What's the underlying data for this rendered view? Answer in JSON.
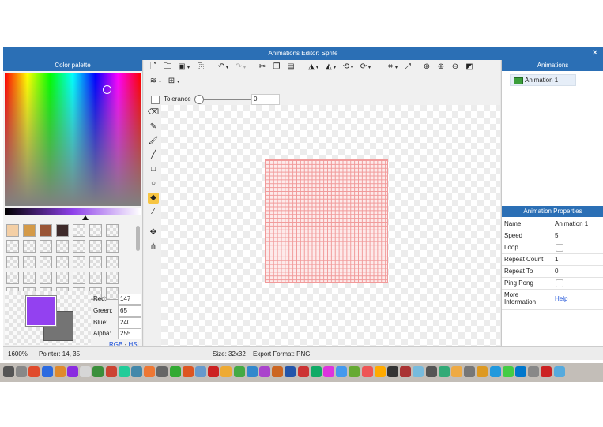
{
  "window": {
    "title": "Animations Editor: Sprite",
    "close": "✕"
  },
  "palette": {
    "title": "Color palette",
    "swatches": [
      "#f4cfa5",
      "#d49a48",
      "#9a5536",
      "#3e2a2a"
    ],
    "red_label": "Red:",
    "red": "147",
    "green_label": "Green:",
    "green": "65",
    "blue_label": "Blue:",
    "blue": "240",
    "alpha_label": "Alpha:",
    "alpha": "255",
    "rgb_link": "RGB",
    "link_sep": " - ",
    "hsl_link": "HSL",
    "primary_color": "#9341f0",
    "secondary_color": "#747474"
  },
  "options": {
    "tolerance_label": "Tolerance",
    "tolerance": "0"
  },
  "animations": {
    "title": "Animations",
    "items": [
      "Animation 1"
    ]
  },
  "properties": {
    "title": "Animation Properties",
    "rows": [
      {
        "key": "Name",
        "value": "Animation 1"
      },
      {
        "key": "Speed",
        "value": "5"
      },
      {
        "key": "Loop",
        "value": ""
      },
      {
        "key": "Repeat Count",
        "value": "1"
      },
      {
        "key": "Repeat To",
        "value": "0"
      },
      {
        "key": "Ping Pong",
        "value": ""
      },
      {
        "key": "More\nInformation",
        "value": "Help"
      }
    ]
  },
  "status": {
    "zoom": "1600%",
    "pointer": "Pointer: 14, 35",
    "size": "Size: 32x32",
    "format": "Export Format: PNG"
  },
  "canvas": {
    "grid_color": "#f19a9a"
  }
}
